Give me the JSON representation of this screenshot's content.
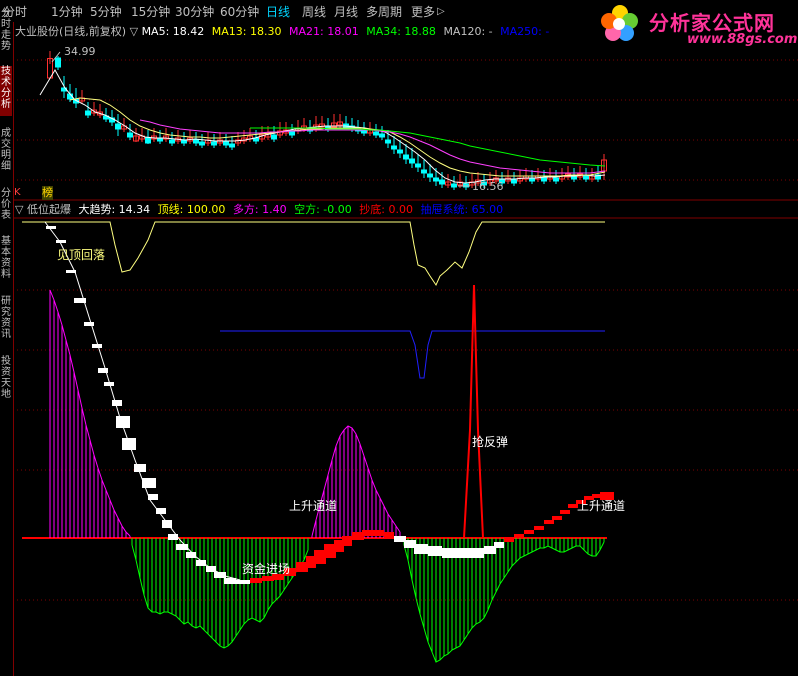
{
  "toolbar": {
    "items": [
      "分时",
      "1分钟",
      "5分钟",
      "15分钟",
      "30分钟",
      "60分钟",
      "日线",
      "周线",
      "月线",
      "多周期",
      "更多"
    ],
    "active": "日线",
    "more_arrow": "▷"
  },
  "logo": {
    "text": "分析家公式网",
    "url": "www.88gs.com",
    "icon": "flower-icon"
  },
  "sidebar": {
    "tabs": [
      "分时走势",
      "技术分析",
      "成交明细",
      "分价表",
      "基本资料",
      "研究资讯",
      "投资天地"
    ],
    "active": "技术分析"
  },
  "main_panel": {
    "stock_label": "大业股份(日线,前复权)",
    "marker": "▽",
    "ma": [
      {
        "label": "MA5: 18.42",
        "color": "#ffffff"
      },
      {
        "label": "MA13: 18.30",
        "color": "#ffff00"
      },
      {
        "label": "MA21: 18.01",
        "color": "#ff00ff"
      },
      {
        "label": "MA34: 18.88",
        "color": "#00ff00"
      },
      {
        "label": "MA120: -",
        "color": "#c0c0c0"
      },
      {
        "label": "MA250: -",
        "color": "#0000ff"
      }
    ],
    "high_label": "34.99",
    "low_label": "16.56",
    "marks": [
      "K",
      "榜"
    ],
    "colors": {
      "up": "#ff3030",
      "down": "#00ffff",
      "ma5": "#ffffff",
      "ma13": "#ffff80",
      "ma21": "#ff40ff",
      "ma34": "#00ff00"
    }
  },
  "indicator_panel": {
    "name": "低位起爆",
    "marker": "▽",
    "values": [
      {
        "label": "大趋势: 14.34",
        "color": "#ffffff"
      },
      {
        "label": "顶线: 100.00",
        "color": "#ffff00"
      },
      {
        "label": "多方: 1.40",
        "color": "#ff00ff"
      },
      {
        "label": "空方: -0.00",
        "color": "#00ff00"
      },
      {
        "label": "抄底: 0.00",
        "color": "#ff0000"
      },
      {
        "label": "抽屉系统: 65.00",
        "color": "#0000ff"
      }
    ],
    "annotations": [
      {
        "text": "见顶回落",
        "color": "#ffff80"
      },
      {
        "text": "资金进场",
        "color": "#ffffff"
      },
      {
        "text": "上升通道",
        "color": "#ffffff"
      },
      {
        "text": "抢反弹",
        "color": "#ffffff"
      },
      {
        "text": "上升通道",
        "color": "#ffffff"
      }
    ]
  }
}
